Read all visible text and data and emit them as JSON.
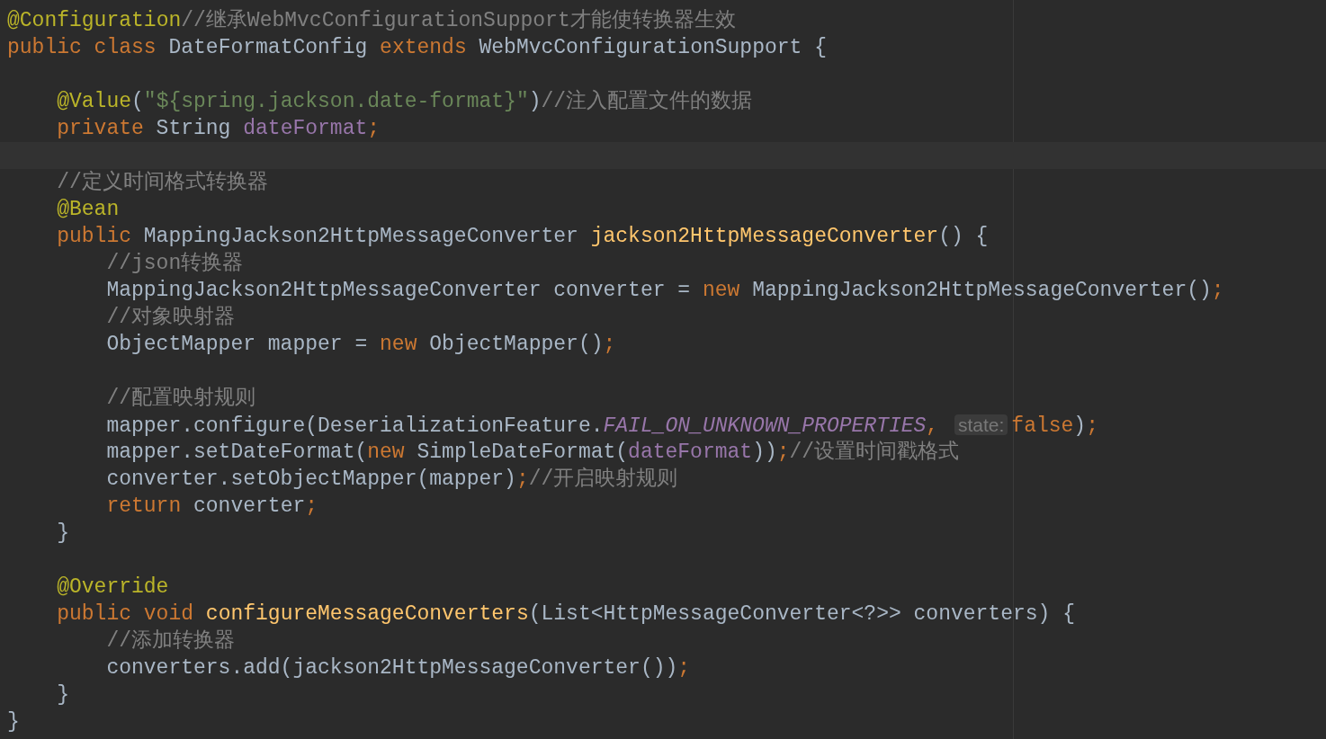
{
  "editor": {
    "lines": [
      {
        "kind": "code",
        "tokens": [
          {
            "kind": "annotation",
            "text": "@Configuration"
          },
          {
            "kind": "comment",
            "text": "//继承WebMvcConfigurationSupport才能使转换器生效"
          }
        ]
      },
      {
        "kind": "code",
        "tokens": [
          {
            "kind": "keyword",
            "text": "public class "
          },
          {
            "kind": "plain",
            "text": "DateFormatConfig "
          },
          {
            "kind": "keyword",
            "text": "extends "
          },
          {
            "kind": "plain",
            "text": "WebMvcConfigurationSupport {"
          }
        ]
      },
      {
        "kind": "blank"
      },
      {
        "kind": "code",
        "tokens": [
          {
            "kind": "annotation",
            "text": "    @Value"
          },
          {
            "kind": "plain",
            "text": "("
          },
          {
            "kind": "string",
            "text": "\"${spring.jackson.date-format}\""
          },
          {
            "kind": "plain",
            "text": ")"
          },
          {
            "kind": "comment",
            "text": "//注入配置文件的数据"
          }
        ]
      },
      {
        "kind": "code",
        "tokens": [
          {
            "kind": "keyword",
            "text": "    private "
          },
          {
            "kind": "plain",
            "text": "String "
          },
          {
            "kind": "field",
            "text": "dateFormat"
          },
          {
            "kind": "keyword",
            "text": ";"
          }
        ]
      },
      {
        "kind": "caret_blank"
      },
      {
        "kind": "code",
        "tokens": [
          {
            "kind": "comment",
            "text": "    //定义时间格式转换器"
          }
        ]
      },
      {
        "kind": "code",
        "tokens": [
          {
            "kind": "annotation",
            "text": "    @Bean"
          }
        ]
      },
      {
        "kind": "code",
        "tokens": [
          {
            "kind": "keyword",
            "text": "    public "
          },
          {
            "kind": "plain",
            "text": "MappingJackson2HttpMessageConverter "
          },
          {
            "kind": "method",
            "text": "jackson2HttpMessageConverter"
          },
          {
            "kind": "plain",
            "text": "() {"
          }
        ]
      },
      {
        "kind": "code",
        "tokens": [
          {
            "kind": "comment",
            "text": "        //json转换器"
          }
        ]
      },
      {
        "kind": "code",
        "tokens": [
          {
            "kind": "plain",
            "text": "        MappingJackson2HttpMessageConverter converter = "
          },
          {
            "kind": "keyword",
            "text": "new "
          },
          {
            "kind": "plain",
            "text": "MappingJackson2HttpMessageConverter()"
          },
          {
            "kind": "keyword",
            "text": ";"
          }
        ]
      },
      {
        "kind": "code",
        "tokens": [
          {
            "kind": "comment",
            "text": "        //对象映射器"
          }
        ]
      },
      {
        "kind": "code",
        "tokens": [
          {
            "kind": "plain",
            "text": "        ObjectMapper mapper = "
          },
          {
            "kind": "keyword",
            "text": "new "
          },
          {
            "kind": "plain",
            "text": "ObjectMapper()"
          },
          {
            "kind": "keyword",
            "text": ";"
          }
        ]
      },
      {
        "kind": "blank"
      },
      {
        "kind": "code",
        "tokens": [
          {
            "kind": "comment",
            "text": "        //配置映射规则"
          }
        ]
      },
      {
        "kind": "code",
        "tokens": [
          {
            "kind": "plain",
            "text": "        mapper.configure(DeserializationFeature."
          },
          {
            "kind": "static",
            "text": "FAIL_ON_UNKNOWN_PROPERTIES"
          },
          {
            "kind": "keyword",
            "text": ", "
          },
          {
            "kind": "hint",
            "text": "state:"
          },
          {
            "kind": "keyword",
            "text": "false"
          },
          {
            "kind": "plain",
            "text": ")"
          },
          {
            "kind": "keyword",
            "text": ";"
          }
        ]
      },
      {
        "kind": "code",
        "tokens": [
          {
            "kind": "plain",
            "text": "        mapper.setDateFormat("
          },
          {
            "kind": "keyword",
            "text": "new "
          },
          {
            "kind": "plain",
            "text": "SimpleDateFormat("
          },
          {
            "kind": "field",
            "text": "dateFormat"
          },
          {
            "kind": "plain",
            "text": "))"
          },
          {
            "kind": "keyword",
            "text": ";"
          },
          {
            "kind": "comment",
            "text": "//设置时间戳格式"
          }
        ]
      },
      {
        "kind": "code",
        "tokens": [
          {
            "kind": "plain",
            "text": "        converter.setObjectMapper(mapper)"
          },
          {
            "kind": "keyword",
            "text": ";"
          },
          {
            "kind": "comment",
            "text": "//开启映射规则"
          }
        ]
      },
      {
        "kind": "code",
        "tokens": [
          {
            "kind": "keyword",
            "text": "        return "
          },
          {
            "kind": "plain",
            "text": "converter"
          },
          {
            "kind": "keyword",
            "text": ";"
          }
        ]
      },
      {
        "kind": "code",
        "tokens": [
          {
            "kind": "plain",
            "text": "    }"
          }
        ]
      },
      {
        "kind": "blank"
      },
      {
        "kind": "code",
        "tokens": [
          {
            "kind": "annotation",
            "text": "    @Override"
          }
        ]
      },
      {
        "kind": "code",
        "tokens": [
          {
            "kind": "keyword",
            "text": "    public void "
          },
          {
            "kind": "method",
            "text": "configureMessageConverters"
          },
          {
            "kind": "plain",
            "text": "(List<HttpMessageConverter<?>> converters) {"
          }
        ]
      },
      {
        "kind": "code",
        "tokens": [
          {
            "kind": "comment",
            "text": "        //添加转换器"
          }
        ]
      },
      {
        "kind": "code",
        "tokens": [
          {
            "kind": "plain",
            "text": "        converters.add(jackson2HttpMessageConverter())"
          },
          {
            "kind": "keyword",
            "text": ";"
          }
        ]
      },
      {
        "kind": "code",
        "tokens": [
          {
            "kind": "plain",
            "text": "    }"
          }
        ]
      },
      {
        "kind": "code",
        "tokens": [
          {
            "kind": "plain",
            "text": "}"
          }
        ]
      }
    ]
  }
}
